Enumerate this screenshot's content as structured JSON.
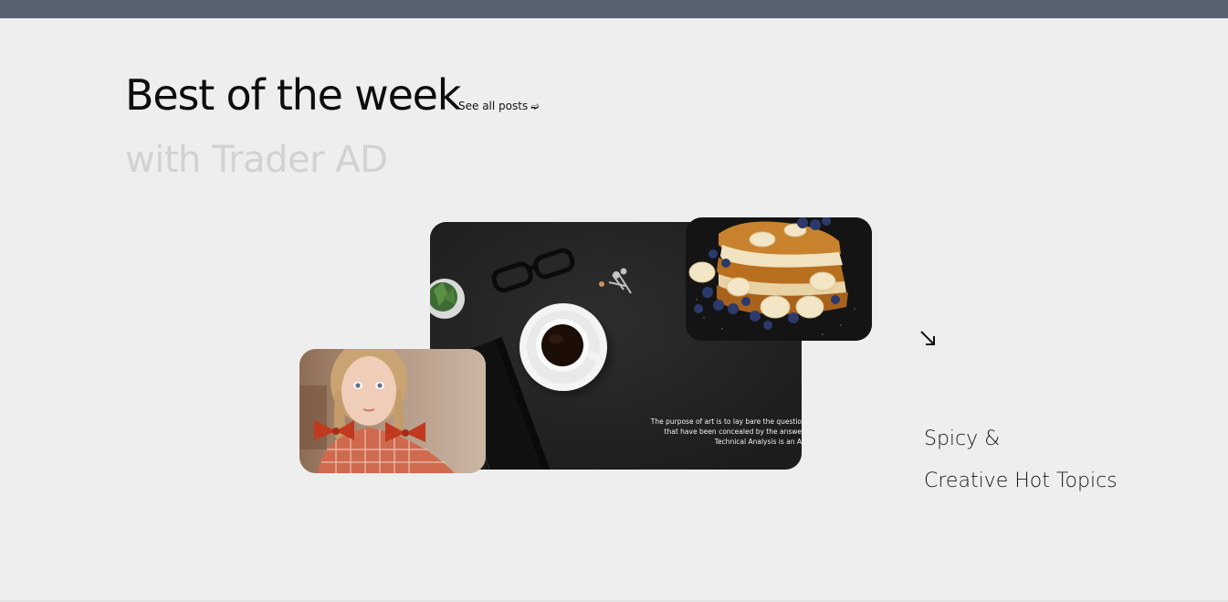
{
  "header": {
    "title": "Best of the week",
    "see_all_label": "See all posts",
    "see_all_icon": "arrow-right-icon",
    "subtitle": "with Trader AD"
  },
  "gallery": {
    "main_card": {
      "quote_lines": [
        "The purpose of art is to lay bare the questio",
        "that have been concealed by the answe",
        "Technical Analysis is an A"
      ],
      "image": "coffee-desk-flatlay"
    },
    "food_card": {
      "image": "french-toast-berries"
    },
    "portrait_card": {
      "image": "girl-portrait"
    }
  },
  "topics": {
    "arrow_icon": "arrow-down-right-icon",
    "line1": "Spicy &",
    "line2": "Creative Hot Topics"
  },
  "colors": {
    "topbar": "#566270",
    "background": "#eeeeee",
    "subtitle": "#d2d2d2",
    "card_dark": "#252525"
  }
}
